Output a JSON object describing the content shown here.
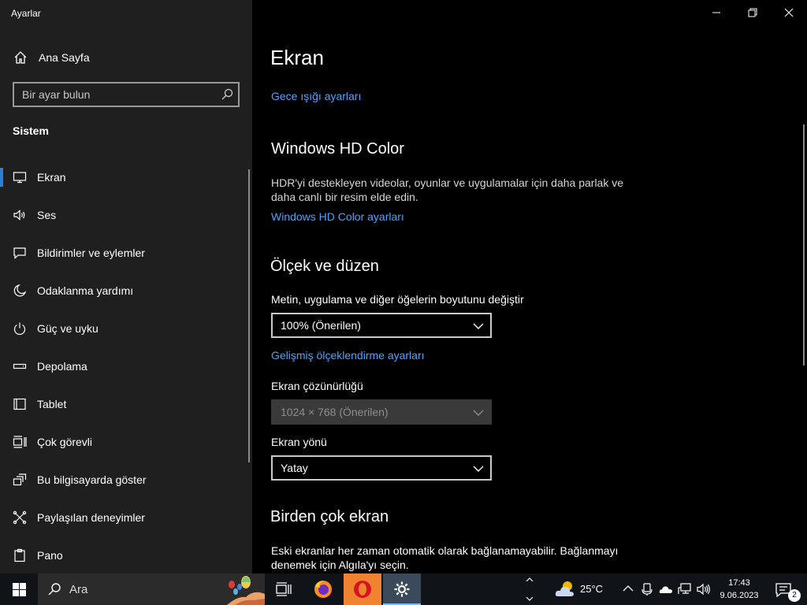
{
  "window": {
    "app_title": "Ayarlar"
  },
  "sidebar": {
    "home_label": "Ana Sayfa",
    "search_placeholder": "Bir ayar bulun",
    "section_title": "Sistem",
    "items": [
      {
        "label": "Ekran",
        "icon": "monitor-icon",
        "active": true
      },
      {
        "label": "Ses",
        "icon": "speaker-icon"
      },
      {
        "label": "Bildirimler ve eylemler",
        "icon": "notification-icon"
      },
      {
        "label": "Odaklanma yardımı",
        "icon": "moon-icon"
      },
      {
        "label": "Güç ve uyku",
        "icon": "power-icon"
      },
      {
        "label": "Depolama",
        "icon": "storage-icon"
      },
      {
        "label": "Tablet",
        "icon": "tablet-icon"
      },
      {
        "label": "Çok görevli",
        "icon": "multitask-icon"
      },
      {
        "label": "Bu bilgisayarda göster",
        "icon": "project-icon"
      },
      {
        "label": "Paylaşılan deneyimler",
        "icon": "shared-icon"
      },
      {
        "label": "Pano",
        "icon": "clipboard-icon"
      }
    ]
  },
  "main": {
    "title": "Ekran",
    "night_light_link": "Gece ışığı ayarları",
    "hdr": {
      "heading": "Windows HD Color",
      "description": "HDR'yi destekleyen videolar, oyunlar ve uygulamalar için daha parlak ve daha canlı bir resim elde edin.",
      "link": "Windows HD Color ayarları"
    },
    "scale": {
      "heading": "Ölçek ve düzen",
      "size_label": "Metin, uygulama ve diğer öğelerin boyutunu değiştir",
      "size_value": "100% (Önerilen)",
      "advanced_link": "Gelişmiş ölçeklendirme ayarları",
      "resolution_label": "Ekran çözünürlüğü",
      "resolution_value": "1024 × 768 (Önerilen)",
      "orientation_label": "Ekran yönü",
      "orientation_value": "Yatay"
    },
    "multi": {
      "heading": "Birden çok ekran",
      "description": "Eski ekranlar her zaman otomatik olarak bağlanamayabilir. Bağlanmayı denemek için Algıla'yı seçin."
    }
  },
  "taskbar": {
    "search_placeholder": "Ara",
    "weather_temp": "25°C",
    "time": "17:43",
    "date": "9.06.2023",
    "notification_count": "2"
  },
  "colors": {
    "accent": "#2e7fd6",
    "link": "#4ba3ff",
    "sidebar_bg": "#1f1f1f",
    "opera_bg": "#f08232"
  }
}
